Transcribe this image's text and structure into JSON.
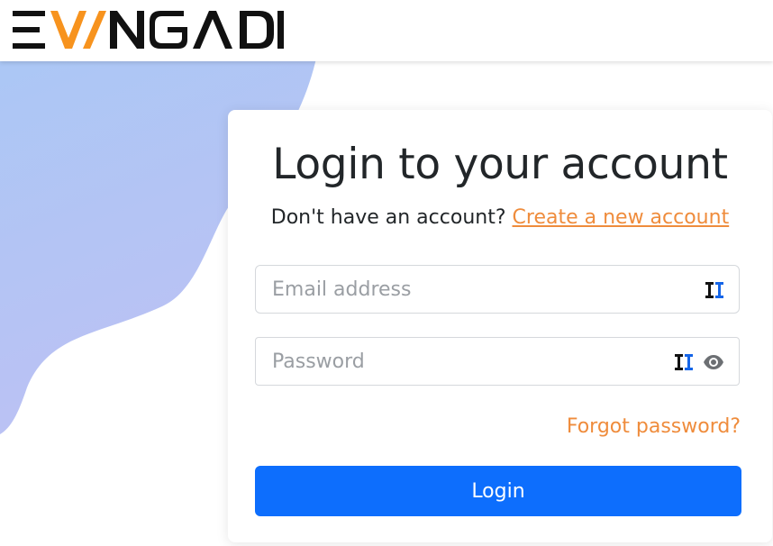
{
  "header": {
    "logo_alt": "EVANGADI"
  },
  "login": {
    "title": "Login to your account",
    "signup_prompt": "Don't have an account?",
    "signup_link": "Create a new account",
    "email_placeholder": "Email address",
    "password_placeholder": "Password",
    "forgot_label": "Forgot password?",
    "login_label": "Login"
  },
  "colors": {
    "accent_orange": "#ef8c3c",
    "primary_blue": "#0d6efd",
    "blob_top": "#a9c8f5",
    "blob_bottom": "#bcc1f4"
  },
  "icons": {
    "email_field_extension": "password-manager-icon",
    "password_field_extension": "password-manager-icon",
    "password_toggle": "eye-icon"
  }
}
